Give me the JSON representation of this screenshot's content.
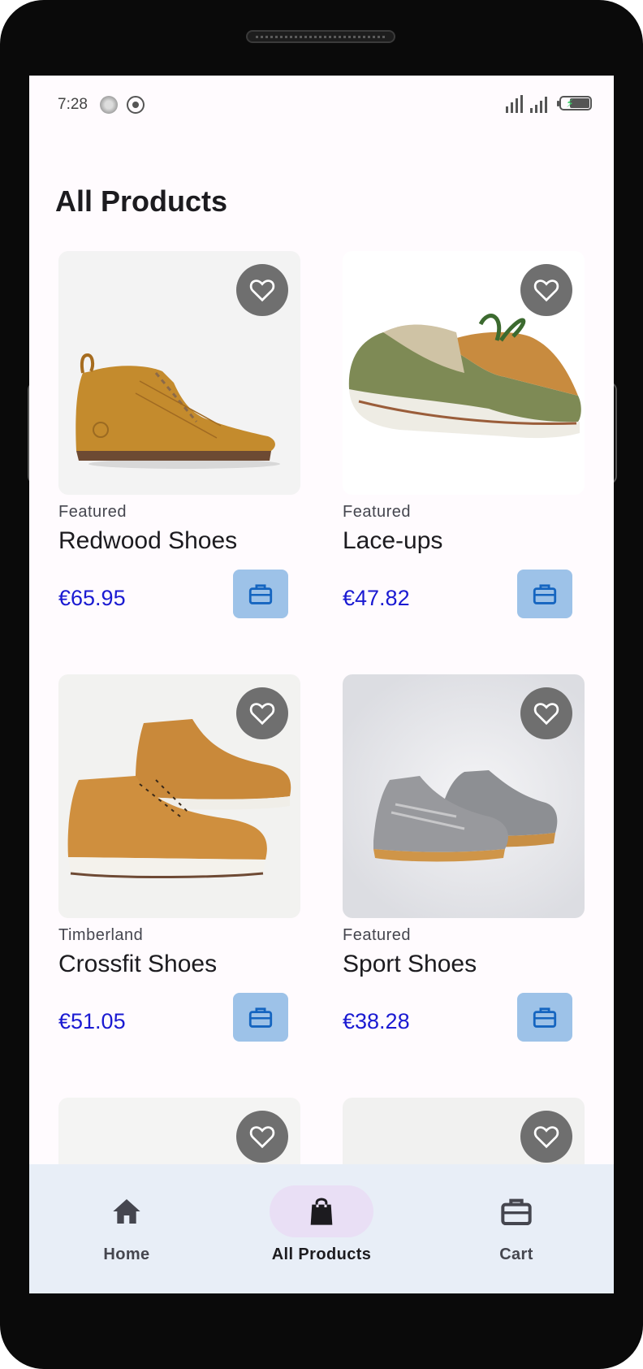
{
  "status_bar": {
    "time": "7:28"
  },
  "page": {
    "title": "All Products"
  },
  "products": [
    {
      "brand": "Featured",
      "name": "Redwood Shoes",
      "price": "€65.95",
      "image": "tan-leather-chukka-boot"
    },
    {
      "brand": "Featured",
      "name": "Lace-ups",
      "price": "€47.82",
      "image": "green-tan-boat-shoe"
    },
    {
      "brand": "Timberland",
      "name": "Crossfit Shoes",
      "price": "€51.05",
      "image": "tan-sneaker-boots-pair"
    },
    {
      "brand": "Featured",
      "name": "Sport Shoes",
      "price": "€38.28",
      "image": "grey-sneakers-pair"
    }
  ],
  "bottom_nav": {
    "items": [
      {
        "label": "Home",
        "icon": "home-icon"
      },
      {
        "label": "All Products",
        "icon": "shopping-bag-icon",
        "active": true
      },
      {
        "label": "Cart",
        "icon": "briefcase-icon"
      }
    ]
  },
  "colors": {
    "price": "#1a1ad2",
    "cart_button": "#9dc2e8",
    "active_pill": "#e9dff5",
    "nav_bg": "#e8eef7"
  }
}
